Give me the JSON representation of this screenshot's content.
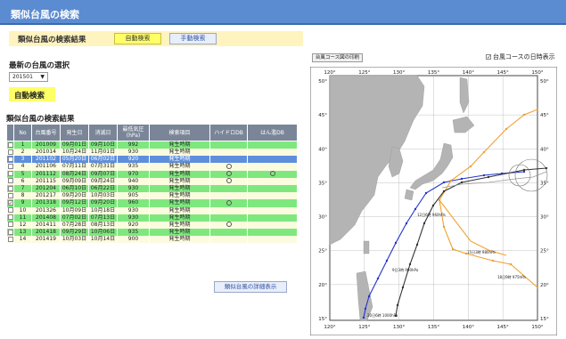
{
  "title": "類似台風の検索",
  "section": {
    "heading": "類似台風の検索結果",
    "auto_button": "自動検索",
    "manual_button": "手動検索"
  },
  "selector": {
    "heading": "最新の台風の選択",
    "value": "201501"
  },
  "auto_label": "自動検索",
  "results": {
    "heading": "類似台風の検索結果",
    "columns": [
      "No",
      "台風番号",
      "発生日",
      "消滅日",
      "最低気圧(hPa)",
      "検索項目",
      "ハイドロDB",
      "はん濫DB"
    ],
    "rows": [
      {
        "no": "1",
        "id": "201009",
        "start": "09月01日",
        "end": "09月10日",
        "pressure": "992",
        "item": "発生時期",
        "hydro": "",
        "flood": "",
        "checked": "",
        "style": "g"
      },
      {
        "no": "2",
        "id": "201014",
        "start": "10月24日",
        "end": "11月01日",
        "pressure": "930",
        "item": "発生時期",
        "hydro": "",
        "flood": "",
        "checked": "",
        "style": "y"
      },
      {
        "no": "3",
        "id": "201102",
        "start": "05月20日",
        "end": "06月02日",
        "pressure": "920",
        "item": "発生時期",
        "hydro": "",
        "flood": "",
        "checked": "",
        "style": "b"
      },
      {
        "no": "4",
        "id": "201106",
        "start": "07月11日",
        "end": "07月31日",
        "pressure": "935",
        "item": "発生時期",
        "hydro": "○",
        "flood": "",
        "checked": "",
        "style": "y"
      },
      {
        "no": "5",
        "id": "201112",
        "start": "08月24日",
        "end": "09月07日",
        "pressure": "970",
        "item": "発生時期",
        "hydro": "○",
        "flood": "○",
        "checked": "",
        "style": "g"
      },
      {
        "no": "6",
        "id": "201115",
        "start": "09月09日",
        "end": "09月24日",
        "pressure": "940",
        "item": "発生時期",
        "hydro": "○",
        "flood": "",
        "checked": "",
        "style": "y"
      },
      {
        "no": "7",
        "id": "201204",
        "start": "06月10日",
        "end": "06月22日",
        "pressure": "930",
        "item": "発生時期",
        "hydro": "",
        "flood": "",
        "checked": "",
        "style": "g"
      },
      {
        "no": "8",
        "id": "201217",
        "start": "09月20日",
        "end": "10月03日",
        "pressure": "905",
        "item": "発生時期",
        "hydro": "",
        "flood": "",
        "checked": "",
        "style": "y"
      },
      {
        "no": "9",
        "id": "201318",
        "start": "09月12日",
        "end": "09月20日",
        "pressure": "960",
        "item": "発生時期",
        "hydro": "○",
        "flood": "",
        "checked": "✓",
        "style": "g"
      },
      {
        "no": "10",
        "id": "201326",
        "start": "10月09日",
        "end": "10月18日",
        "pressure": "930",
        "item": "発生時期",
        "hydro": "",
        "flood": "",
        "checked": "",
        "style": "y"
      },
      {
        "no": "11",
        "id": "201408",
        "start": "07月02日",
        "end": "07月13日",
        "pressure": "930",
        "item": "発生時期",
        "hydro": "",
        "flood": "",
        "checked": "",
        "style": "g"
      },
      {
        "no": "12",
        "id": "201411",
        "start": "07月28日",
        "end": "08月13日",
        "pressure": "920",
        "item": "発生時期",
        "hydro": "○",
        "flood": "",
        "checked": "",
        "style": "y"
      },
      {
        "no": "13",
        "id": "201418",
        "start": "09月29日",
        "end": "10月06日",
        "pressure": "935",
        "item": "発生時期",
        "hydro": "",
        "flood": "",
        "checked": "",
        "style": "g"
      },
      {
        "no": "14",
        "id": "201419",
        "start": "10月03日",
        "end": "10月14日",
        "pressure": "900",
        "item": "発生時期",
        "hydro": "",
        "flood": "",
        "checked": "",
        "style": "y"
      }
    ],
    "detail_button": "類似台風の詳細表示"
  },
  "map": {
    "print_button": "台風コース図の印刷",
    "show_dates_label": "台風コースの日時表示",
    "show_dates_checked": true,
    "lon_ticks": [
      "120°",
      "125°",
      "130°",
      "135°",
      "140°",
      "145°",
      "150°"
    ],
    "lat_ticks": [
      "50°",
      "45°",
      "40°",
      "35°",
      "30°",
      "25°",
      "20°",
      "15°"
    ],
    "colors": {
      "land": "#b4b4b4",
      "sea": "#ffffff",
      "track_blue": "#2233cc",
      "track_black": "#333333",
      "track_orange": "#f0a030",
      "track_grey": "#999999"
    },
    "track_labels": [
      "9日3時 990hPa",
      "12日6時 960hPa",
      "15日3時 980hPa",
      "18日9時 975hPa",
      "20日6時 1000hPa"
    ]
  },
  "colors": {
    "header": "#5b8bd0",
    "selected_row": "#5f8fdc",
    "green_row": "#7ee87e"
  }
}
